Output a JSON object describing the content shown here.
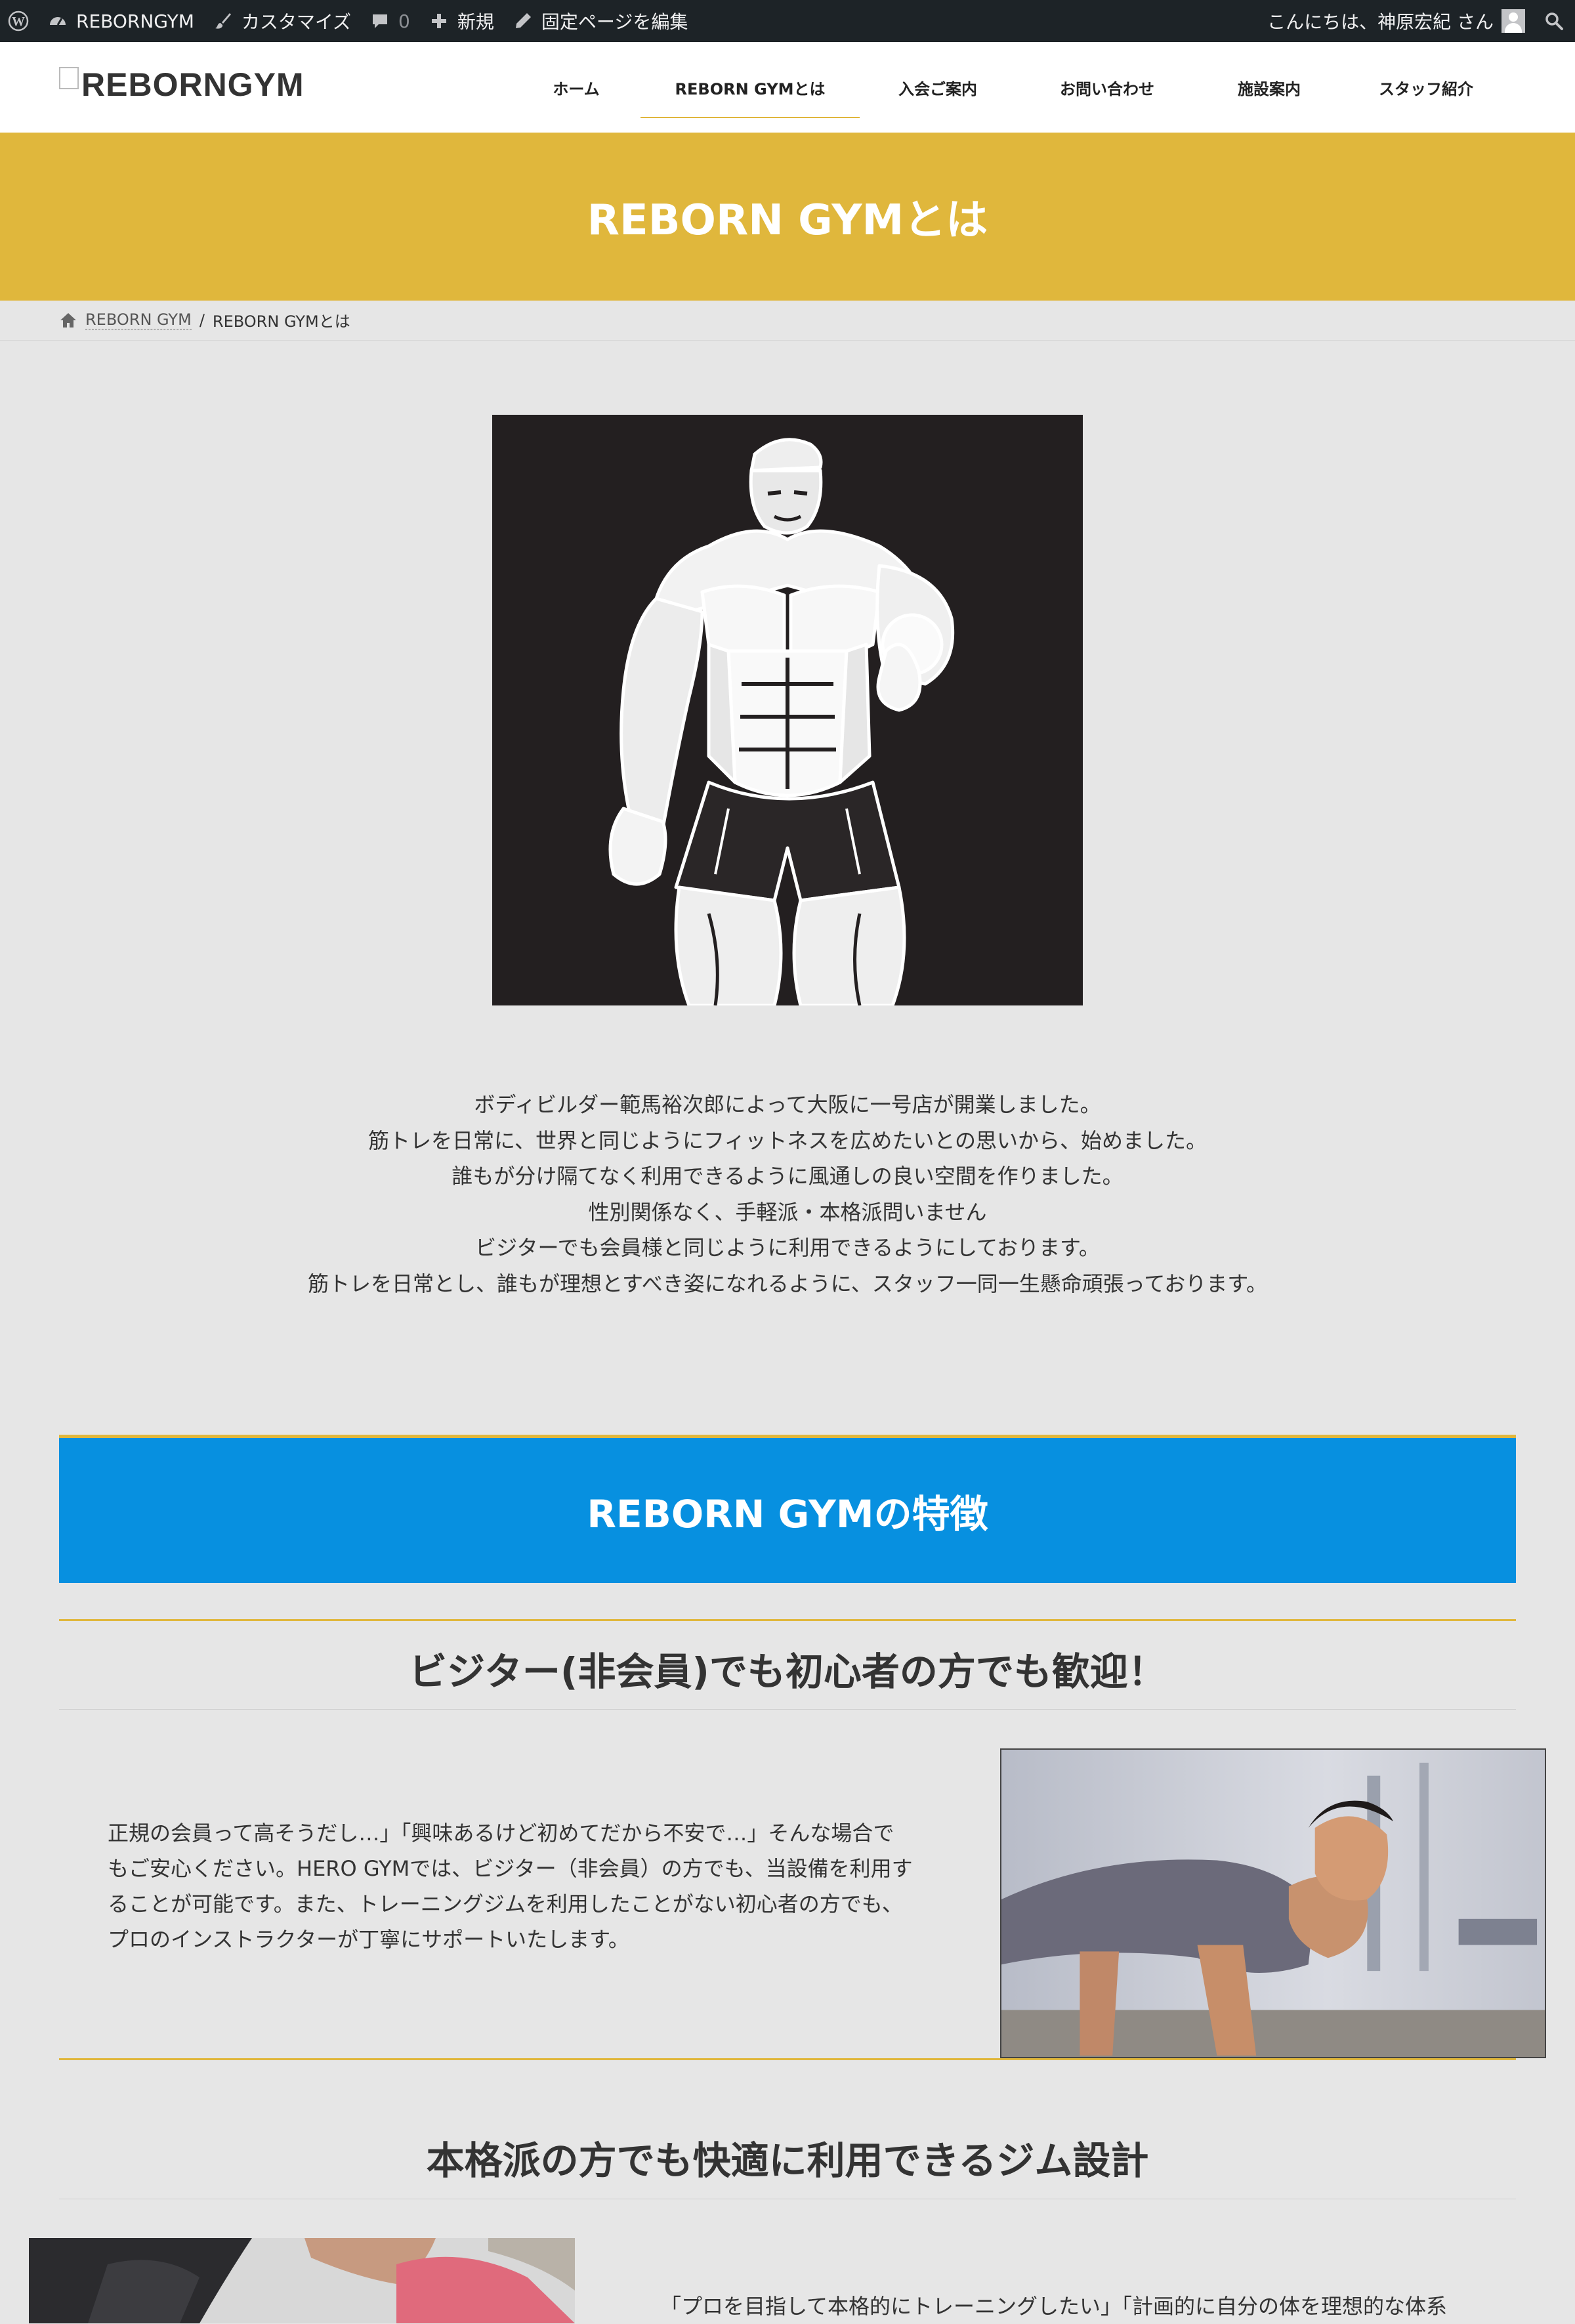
{
  "admin_bar": {
    "site_name": "REBORNGYM",
    "customize": "カスタマイズ",
    "comments_count": "0",
    "new": "新規",
    "edit_page": "固定ページを編集",
    "greeting": "こんにちは、神原宏紀 さん"
  },
  "header": {
    "logo_text": "REBORNGYM",
    "nav": [
      {
        "label": "ホーム"
      },
      {
        "label": "REBORN GYMとは"
      },
      {
        "label": "入会ご案内"
      },
      {
        "label": "お問い合わせ"
      },
      {
        "label": "施設案内"
      },
      {
        "label": "スタッフ紹介"
      }
    ]
  },
  "page": {
    "title": "REBORN GYMとは",
    "breadcrumb": {
      "home": "REBORN GYM",
      "separator": "/",
      "current": "REBORN GYMとは"
    }
  },
  "intro": {
    "lines": [
      "ボディビルダー範馬裕次郎によって大阪に一号店が開業しました。",
      "筋トレを日常に、世界と同じようにフィットネスを広めたいとの思いから、始めました。",
      "誰もが分け隔てなく利用できるように風通しの良い空間を作りました。",
      "性別関係なく、手軽派・本格派問いません",
      "ビジターでも会員様と同じように利用できるようにしております。",
      "筋トレを日常とし、誰もが理想とすべき姿になれるように、スタッフ一同一生懸命頑張っております。"
    ]
  },
  "features": {
    "banner_title": "REBORN GYMの特徴",
    "items": [
      {
        "heading": "ビジター(非会員)でも初心者の方でも歓迎！",
        "lines": [
          "正規の会員って高そうだし…」「興味あるけど初めてだから不安で…」そんな場合で",
          "もご安心ください。HERO GYMでは、ビジター（非会員）の方でも、当設備を利用す",
          "ることが可能です。また、トレーニングジムを利用したことがない初心者の方でも、",
          "プロのインストラクターが丁寧にサポートいたします。"
        ]
      },
      {
        "heading": "本格派の方でも快適に利用できるジム設計",
        "lines": [
          "「プロを目指して本格的にトレーニングしたい」「計画的に自分の体を理想的な体系"
        ]
      }
    ]
  },
  "colors": {
    "accent_gold": "#e0b73c",
    "accent_blue": "#0790e0",
    "admin_bar": "#1d2327"
  }
}
